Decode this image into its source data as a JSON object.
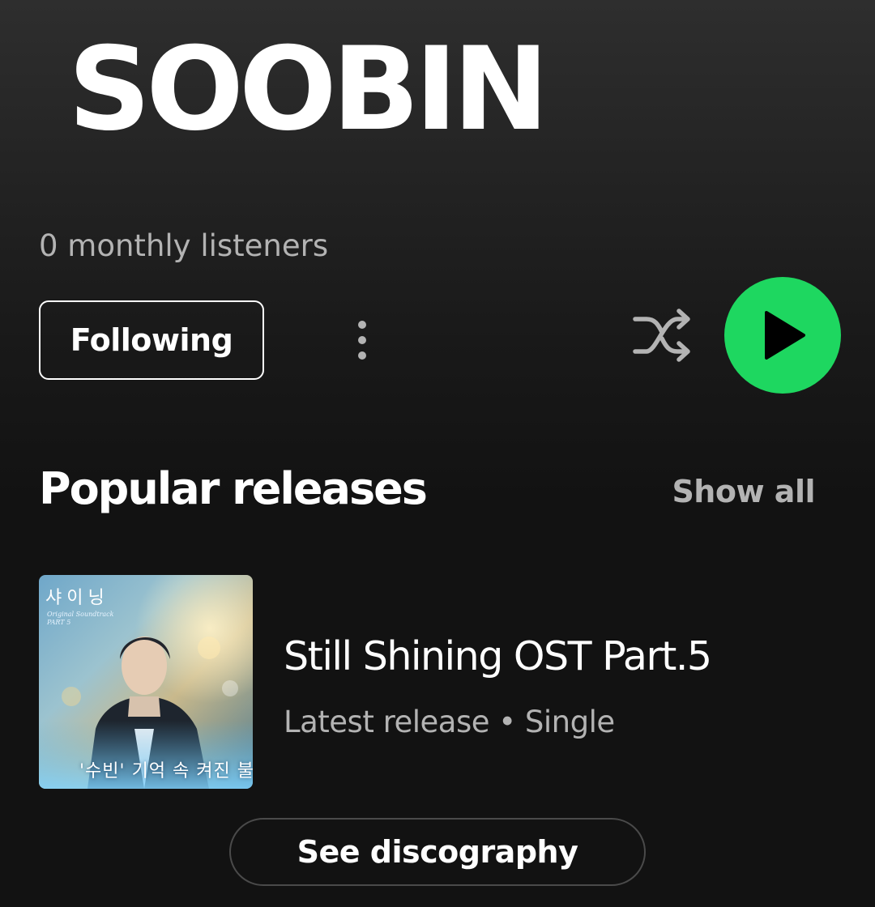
{
  "artist": {
    "name": "SOOBIN",
    "monthly_listeners": "0 monthly listeners"
  },
  "actions": {
    "follow_label": "Following",
    "more_icon": "more-vertical-icon",
    "shuffle_icon": "shuffle-icon",
    "play_icon": "play-icon",
    "play_button_color": "#1ed760"
  },
  "popular_releases": {
    "title": "Popular releases",
    "show_all_label": "Show all",
    "items": [
      {
        "title": "Still Shining OST Part.5",
        "meta": "Latest release • Single",
        "cover": {
          "show_title": "샤이닝",
          "subtitle_line1": "Original Soundtrack",
          "subtitle_line2": "PART 5",
          "caption": "'수빈' 기억 속 켜진 불"
        }
      }
    ],
    "see_discography_label": "See discography"
  },
  "colors": {
    "background": "#121212",
    "text_primary": "#ffffff",
    "text_secondary": "#b3b3b3",
    "accent": "#1ed760"
  }
}
